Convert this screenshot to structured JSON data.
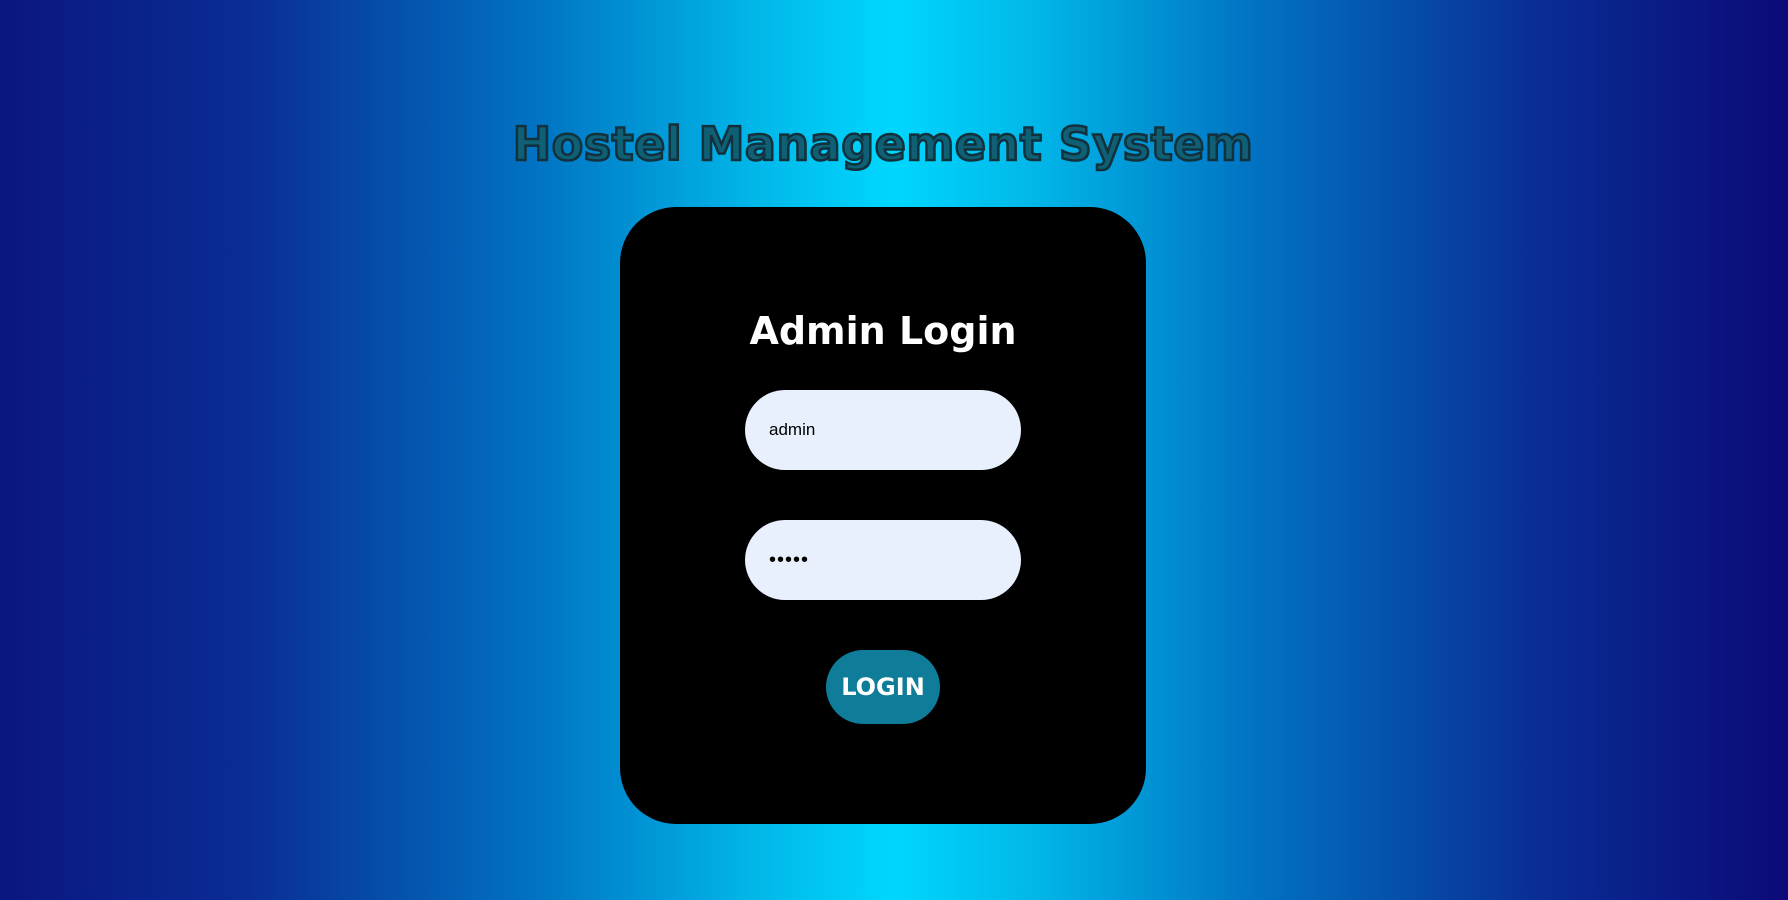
{
  "app": {
    "title": "Hostel Management System"
  },
  "login": {
    "heading": "Admin Login",
    "username_value": "admin",
    "password_value": "•••••",
    "button_label": "LOGIN"
  },
  "colors": {
    "card_background": "#000000",
    "input_background": "#e8f0fe",
    "button_background": "#0f7c99",
    "gradient_center": "#00d7fe",
    "gradient_edge": "#0b1680"
  }
}
